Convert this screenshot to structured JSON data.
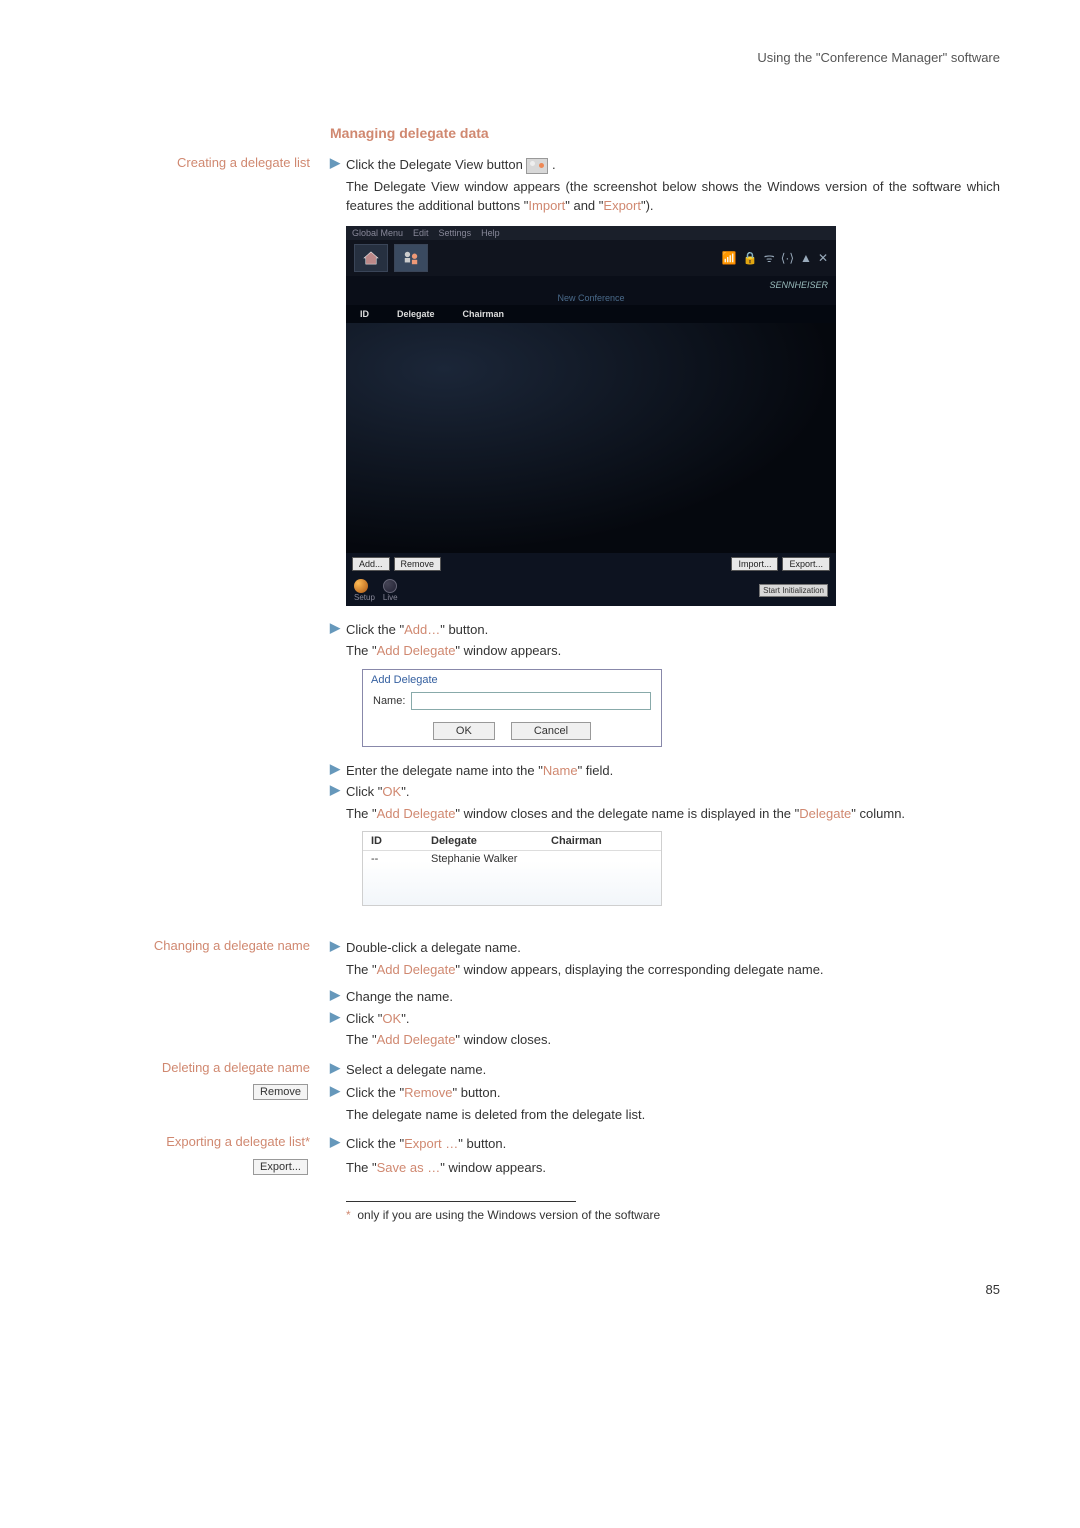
{
  "header": {
    "running_head": "Using the \"Conference Manager\" software"
  },
  "heading": "Managing delegate data",
  "sections": {
    "create": {
      "side": "Creating a delegate list",
      "step1": "Click the Delegate View button ",
      "step1_note_a": "The Delegate View window appears (the screenshot below shows the Windows version of the software which features the additional buttons \"",
      "step1_import": "Import",
      "step1_note_b": "\" and \"",
      "step1_export": "Export",
      "step1_note_c": "\").",
      "step2_a": "Click the \"",
      "step2_add": "Add…",
      "step2_b": "\" button.",
      "step2_note_a": "The \"",
      "step2_adddelegate": "Add Delegate",
      "step2_note_b": "\" window appears.",
      "step3_a": "Enter the delegate name into the \"",
      "step3_name": "Name",
      "step3_b": "\" field.",
      "step4_a": "Click \"",
      "step4_ok": "OK",
      "step4_b": "\".",
      "step4_note_a": "The \"",
      "step4_adddelegate": "Add Delegate",
      "step4_note_b": "\" window closes and the delegate name is displayed in the \"",
      "step4_delegate": "Delegate",
      "step4_note_c": "\" column."
    },
    "change": {
      "side": "Changing a delegate name",
      "step1": "Double-click a delegate name.",
      "step1_note_a": "The \"",
      "step1_adddelegate": "Add Delegate",
      "step1_note_b": "\" window appears, displaying the corresponding delegate name.",
      "step2": "Change the name.",
      "step3_a": "Click \"",
      "step3_ok": "OK",
      "step3_b": "\".",
      "step3_note_a": "The \"",
      "step3_adddelegate": "Add Delegate",
      "step3_note_b": "\" window closes."
    },
    "delete": {
      "side": "Deleting a delegate name",
      "side_btn": "Remove",
      "step1": "Select a delegate name.",
      "step2_a": "Click the \"",
      "step2_remove": "Remove",
      "step2_b": "\" button.",
      "step2_note": "The delegate name is deleted from the delegate list."
    },
    "export": {
      "side": "Exporting a delegate list*",
      "side_btn": "Export...",
      "step1_a": "Click the \"",
      "step1_export": "Export …",
      "step1_b": "\" button.",
      "step1_note_a": "The \"",
      "step1_saveas": "Save as …",
      "step1_note_b": "\" window appears."
    }
  },
  "screenshot": {
    "menus": {
      "global": "Global Menu",
      "edit": "Edit",
      "settings": "Settings",
      "help": "Help"
    },
    "brand": "SENNHEISER",
    "subhead": "New Conference",
    "cols": {
      "id": "ID",
      "delegate": "Delegate",
      "chairman": "Chairman"
    },
    "btns": {
      "add": "Add...",
      "remove": "Remove",
      "import": "Import...",
      "export": "Export..."
    },
    "footer": {
      "setup": "Setup",
      "live": "Live",
      "start": "Start Initialization"
    }
  },
  "dialog": {
    "title": "Add Delegate",
    "name_label": "Name:",
    "ok": "OK",
    "cancel": "Cancel"
  },
  "table": {
    "id": "ID",
    "delegate": "Delegate",
    "chairman": "Chairman",
    "row_id": "--",
    "row_name": "Stephanie Walker"
  },
  "footnote": {
    "marker": "*",
    "text": "only if you are using the Windows version of the software"
  },
  "page_number": "85"
}
